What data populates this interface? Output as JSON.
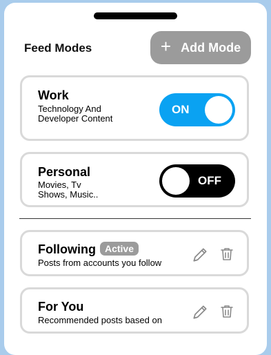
{
  "header": {
    "title": "Feed Modes",
    "add_button_icon": "+",
    "add_button_label": "Add Mode"
  },
  "modes": [
    {
      "title": "Work",
      "description": "Technology And Developer Content",
      "toggle_state": "ON",
      "enabled": true
    },
    {
      "title": "Personal",
      "description": "Movies, Tv Shows, Music..",
      "toggle_state": "OFF",
      "enabled": false
    }
  ],
  "feeds": [
    {
      "title": "Following",
      "badge": "Active",
      "description": "Posts from accounts you follow"
    },
    {
      "title": "For You",
      "badge": "",
      "description": "Recommended posts based on"
    }
  ],
  "icons": {
    "edit": "pencil-icon",
    "delete": "trash-icon"
  },
  "colors": {
    "toggle_on": "#0aa2f2",
    "toggle_off": "#000000",
    "button_gray": "#9b9b9b",
    "background": "#a9ccec"
  }
}
